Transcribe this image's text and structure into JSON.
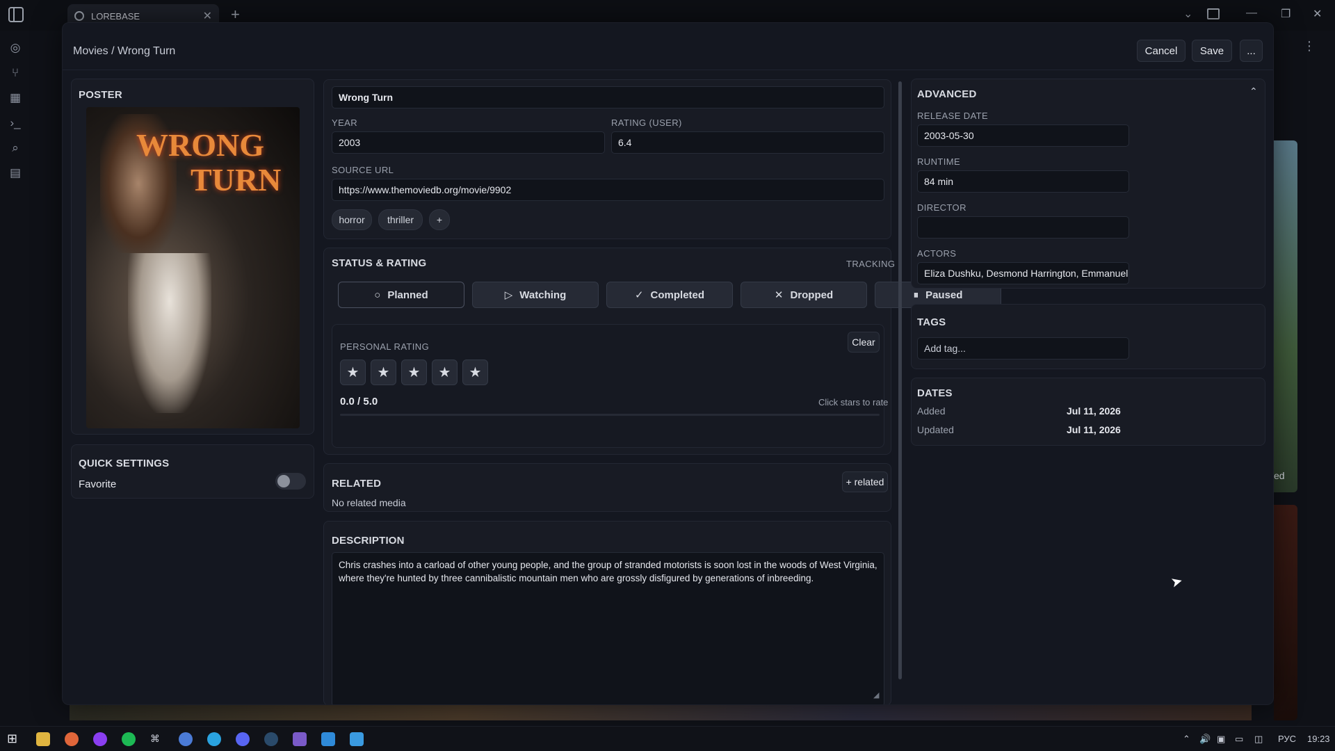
{
  "browser": {
    "tab_title": "LOREBASE",
    "new_tab": "+"
  },
  "header": {
    "breadcrumb": "Movies / Wrong Turn",
    "cancel": "Cancel",
    "save": "Save",
    "more": "..."
  },
  "poster": {
    "title": "POSTER",
    "art_text_1": "WRONG",
    "art_text_2": "TURN"
  },
  "quick_settings": {
    "title": "QUICK SETTINGS",
    "favorite_label": "Favorite",
    "favorite_on": false
  },
  "main": {
    "title_value": "Wrong Turn",
    "year_label": "YEAR",
    "year_value": "2003",
    "rating_label": "RATING (USER)",
    "rating_value": "6.4",
    "source_label": "SOURCE URL",
    "source_value": "https://www.themoviedb.org/movie/9902",
    "genres": [
      "horror",
      "thriller"
    ],
    "add_genre": "+"
  },
  "status": {
    "title": "STATUS & RATING",
    "tracking": "TRACKING",
    "options": [
      {
        "label": "Planned",
        "icon": "○"
      },
      {
        "label": "Watching",
        "icon": "▷"
      },
      {
        "label": "Completed",
        "icon": "✓"
      },
      {
        "label": "Dropped",
        "icon": "✕"
      },
      {
        "label": "Paused",
        "icon": "⏸"
      }
    ],
    "personal_rating_label": "PERSONAL RATING",
    "clear": "Clear",
    "stars": [
      "★",
      "★",
      "★",
      "★",
      "★"
    ],
    "score": "0.0 / 5.0",
    "hint": "Click stars to rate"
  },
  "related": {
    "title": "RELATED",
    "add": "+ related",
    "empty": "No related media"
  },
  "description": {
    "title": "DESCRIPTION",
    "text": "Chris crashes into a carload of other young people, and the group of stranded motorists is soon lost in the woods of West Virginia, where they're hunted by three cannibalistic mountain men who are grossly disfigured by generations of inbreeding."
  },
  "advanced": {
    "title": "ADVANCED",
    "release_label": "RELEASE DATE",
    "release_value": "2003-05-30",
    "runtime_label": "RUNTIME",
    "runtime_value": "84 min",
    "director_label": "DIRECTOR",
    "director_value": "",
    "actors_label": "ACTORS",
    "actors_value": "Eliza Dushku, Desmond Harrington, Emmanuelle Chriqui"
  },
  "tags": {
    "title": "TAGS",
    "placeholder": "Add tag..."
  },
  "dates": {
    "title": "DATES",
    "added_label": "Added",
    "added_value": "Jul 11, 2026",
    "updated_label": "Updated",
    "updated_value": "Jul 11, 2026"
  },
  "background": {
    "partial_text": "ed"
  },
  "taskbar": {
    "lang": "РУС",
    "time": "19:23"
  },
  "colors": {
    "bg": "#0f1117",
    "modal": "#141720",
    "card": "#181b24",
    "field": "#10131a"
  }
}
